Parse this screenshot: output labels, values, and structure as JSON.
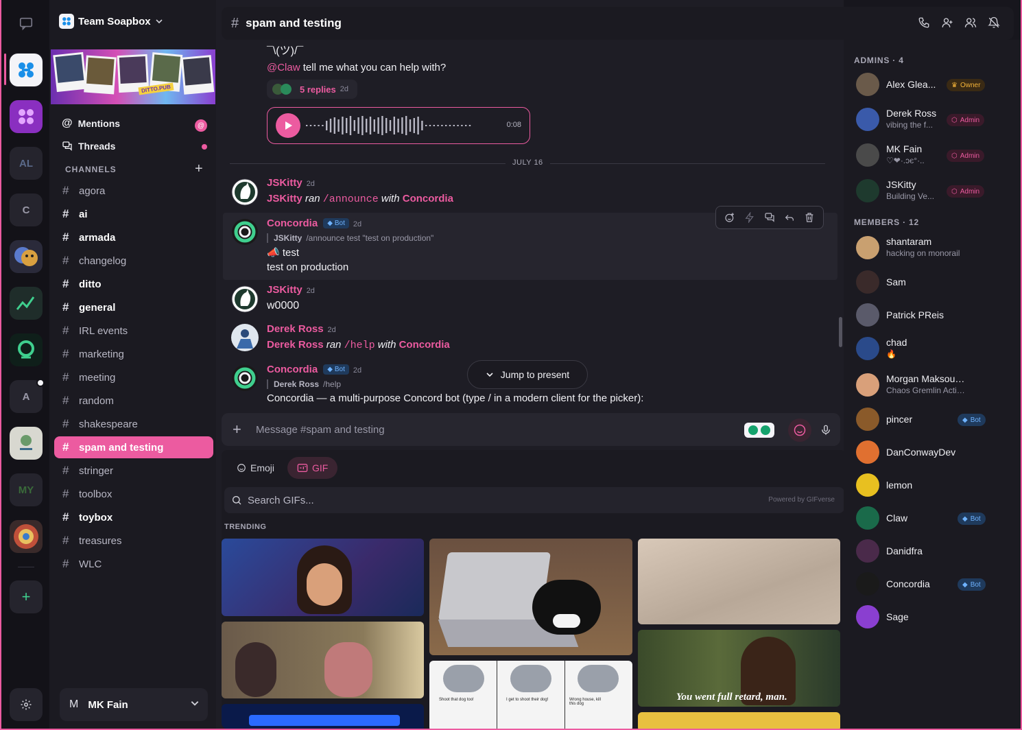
{
  "colors": {
    "accent": "#ec5ba0",
    "bg": "#17161d",
    "panel": "#1b1a21",
    "bot": "#6fb3ff",
    "owner": "#f3b339"
  },
  "rail": {
    "servers": [
      {
        "label": "",
        "icon": "dm-icon"
      },
      {
        "label": "",
        "icon": "soapbox-logo"
      },
      {
        "label": "",
        "icon": "purple-soapbox-logo"
      },
      {
        "label": "AL",
        "icon": ""
      },
      {
        "label": "C",
        "icon": ""
      },
      {
        "label": "",
        "icon": "masks-server"
      },
      {
        "label": "",
        "icon": "chart-server"
      },
      {
        "label": "",
        "icon": "concordia-server"
      },
      {
        "label": "A",
        "icon": ""
      },
      {
        "label": "",
        "icon": "stirrup-server"
      },
      {
        "label": "MY",
        "icon": ""
      },
      {
        "label": "",
        "icon": "pinball-server"
      }
    ],
    "add_label": "+"
  },
  "sidebar": {
    "team_name": "Team Soapbox",
    "banner_caption": "DITTO.PUB",
    "mentions_label": "Mentions",
    "mentions_badge": "@",
    "threads_label": "Threads",
    "channels_header": "CHANNELS",
    "channels": [
      {
        "name": "agora",
        "bold": false
      },
      {
        "name": "ai",
        "bold": true
      },
      {
        "name": "armada",
        "bold": true
      },
      {
        "name": "changelog",
        "bold": false
      },
      {
        "name": "ditto",
        "bold": true
      },
      {
        "name": "general",
        "bold": true
      },
      {
        "name": "IRL events",
        "bold": false
      },
      {
        "name": "marketing",
        "bold": false
      },
      {
        "name": "meeting",
        "bold": false
      },
      {
        "name": "random",
        "bold": false
      },
      {
        "name": "shakespeare",
        "bold": false
      },
      {
        "name": "spam and testing",
        "bold": false,
        "active": true
      },
      {
        "name": "stringer",
        "bold": false
      },
      {
        "name": "toolbox",
        "bold": false
      },
      {
        "name": "toybox",
        "bold": true
      },
      {
        "name": "treasures",
        "bold": false
      },
      {
        "name": "WLC",
        "bold": false
      }
    ],
    "user": {
      "initial": "M",
      "name": "MK Fain"
    }
  },
  "header": {
    "channel": "spam and testing"
  },
  "messages": {
    "shrug": "¯\\(ツ)/¯",
    "claw_mention": "@Claw",
    "claw_text": " tell me what you can help with?",
    "replies_count": "5 replies",
    "replies_time": "2d",
    "voice_duration": "0:08",
    "divider": "JULY 16",
    "items": [
      {
        "author": "JSKitty",
        "time": "2d",
        "prefix": "JSKitty",
        "verb": " ran ",
        "cmd": "/announce",
        "with": " with ",
        "bot": "Concordia"
      },
      {
        "author": "Concordia",
        "bot_tag": "Bot",
        "time": "2d",
        "ref_user": "JSKitty",
        "ref_text": "/announce test \"test on production\"",
        "line1": "📣 test",
        "line2": "test on production"
      },
      {
        "author": "JSKitty",
        "time": "2d",
        "text": "w0000"
      },
      {
        "author": "Derek Ross",
        "time": "2d",
        "prefix": "Derek Ross",
        "verb": " ran ",
        "cmd": "/help",
        "with": " with ",
        "bot": "Concordia"
      },
      {
        "author": "Concordia",
        "bot_tag": "Bot",
        "time": "2d",
        "ref_user": "Derek Ross",
        "ref_text": "/help",
        "text": "Concordia — a multi-purpose Concord bot (type / in a modern client for the picker):"
      }
    ],
    "jump_label": "Jump to present"
  },
  "composer": {
    "placeholder": "Message #spam and testing"
  },
  "picker": {
    "tabs": [
      "Emoji",
      "GIF"
    ],
    "search_placeholder": "Search GIFs...",
    "powered_by": "Powered by GIFverse",
    "trending_label": "TRENDING",
    "gif_caption": "You went full retard, man.",
    "comic_captions": [
      "Shoot that dog too!",
      "I get to shoot their dog!",
      "Wrong house, kill this dog"
    ]
  },
  "members": {
    "admins_header": "ADMINS · 4",
    "members_header": "MEMBERS · 12",
    "admins": [
      {
        "name": "Alex Glea...",
        "status": "",
        "role": "Owner"
      },
      {
        "name": "Derek Ross",
        "status": "vibing the f...",
        "role": "Admin"
      },
      {
        "name": "MK Fain",
        "status": "♡❤·.ɔє°·..",
        "role": "Admin"
      },
      {
        "name": "JSKitty",
        "status": "Building Ve...",
        "role": "Admin"
      }
    ],
    "list": [
      {
        "name": "shantaram",
        "status": "hacking on monorail",
        "role": ""
      },
      {
        "name": "Sam",
        "status": "",
        "role": ""
      },
      {
        "name": "Patrick PReis",
        "status": "",
        "role": ""
      },
      {
        "name": "chad",
        "status": "🔥",
        "role": ""
      },
      {
        "name": "Morgan Maksoud-M...",
        "status": "Chaos Gremlin Actively ...",
        "role": ""
      },
      {
        "name": "pincer",
        "status": "",
        "role": "Bot"
      },
      {
        "name": "DanConwayDev",
        "status": "",
        "role": ""
      },
      {
        "name": "lemon",
        "status": "",
        "role": ""
      },
      {
        "name": "Claw",
        "status": "",
        "role": "Bot"
      },
      {
        "name": "Danidfra",
        "status": "",
        "role": ""
      },
      {
        "name": "Concordia",
        "status": "",
        "role": "Bot"
      },
      {
        "name": "Sage",
        "status": "",
        "role": ""
      }
    ]
  }
}
